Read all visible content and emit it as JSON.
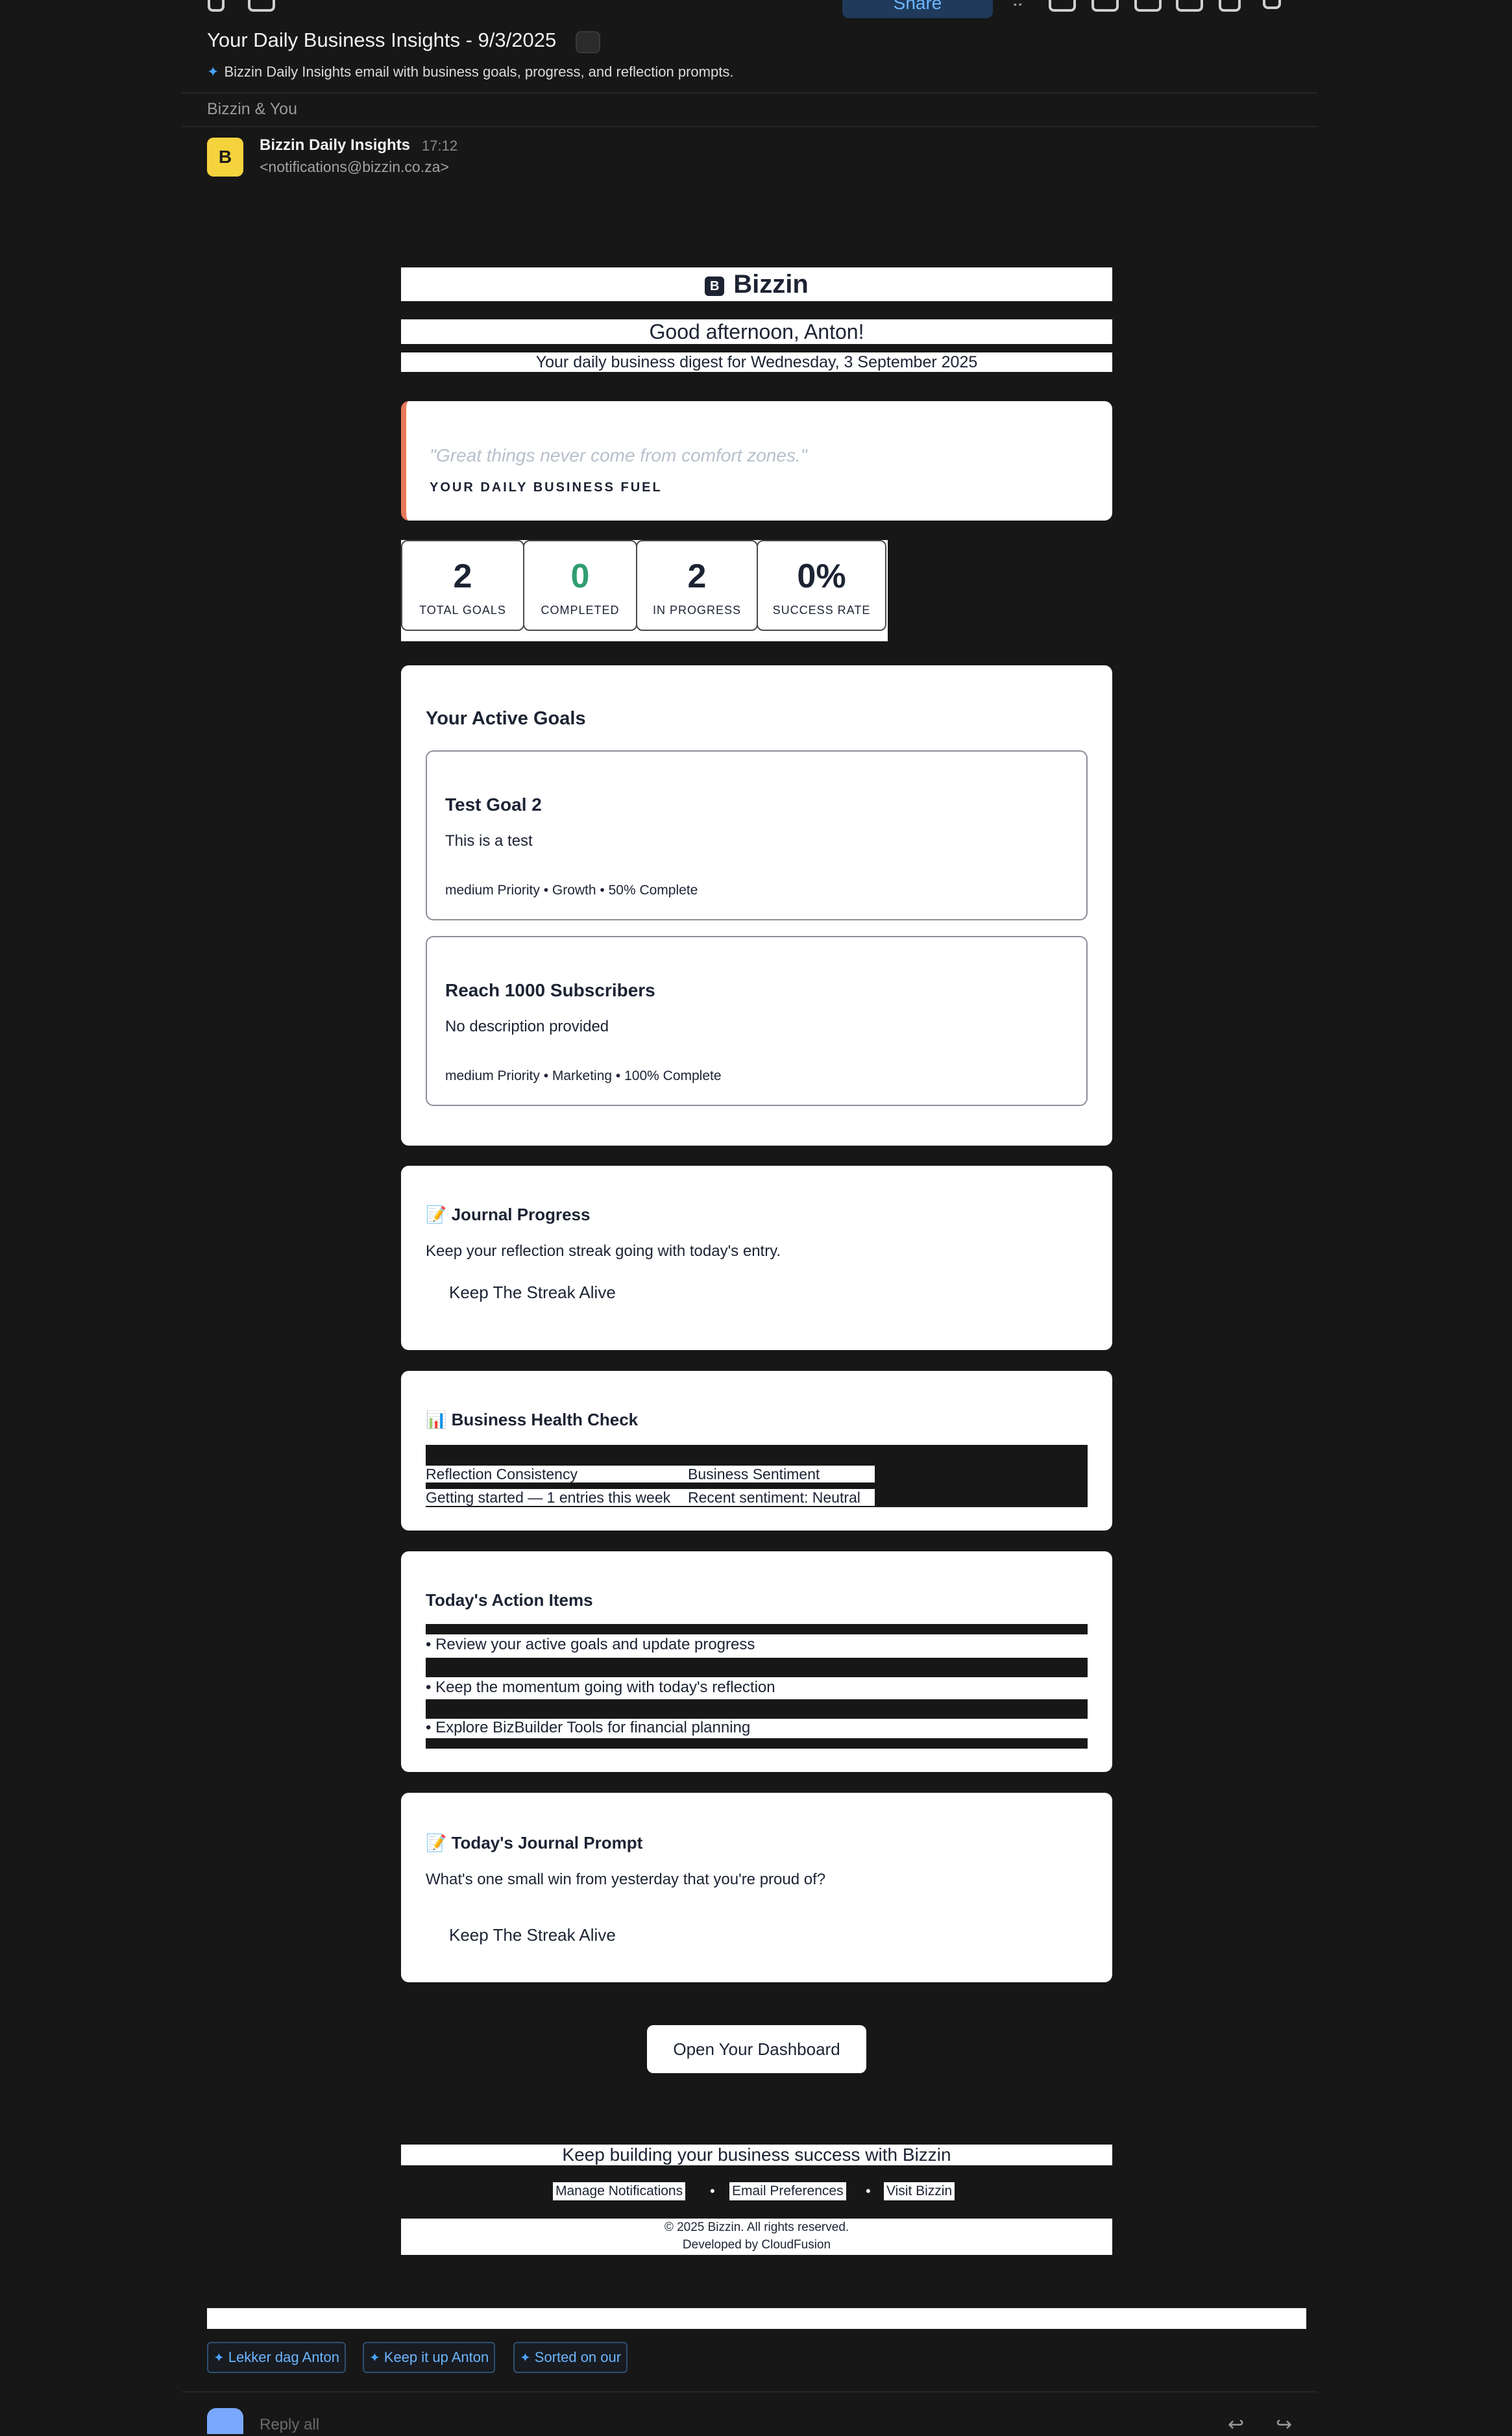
{
  "toolbar": {
    "share_label": "Share"
  },
  "header": {
    "subject": "Your Daily Business Insights - 9/3/2025",
    "summary": "Bizzin Daily Insights email with business goals, progress, and reflection prompts.",
    "thread_label": "Bizzin & You"
  },
  "sender": {
    "avatar_letter": "B",
    "name": "Bizzin Daily Insights",
    "time": "17:12",
    "email": "<notifications@bizzin.co.za>"
  },
  "email": {
    "brand": {
      "logo_letter": "B",
      "name": "Bizzin"
    },
    "greeting": "Good afternoon, Anton!",
    "digest": "Your daily business digest for Wednesday, 3 September 2025",
    "quote": {
      "text": "\"Great things never come from comfort zones.\"",
      "label": "YOUR DAILY BUSINESS FUEL"
    },
    "stats": [
      {
        "value": "2",
        "label": "TOTAL GOALS"
      },
      {
        "value": "0",
        "label": "COMPLETED"
      },
      {
        "value": "2",
        "label": "IN PROGRESS"
      },
      {
        "value": "0%",
        "label": "SUCCESS RATE"
      }
    ],
    "goals": {
      "title": "Your Active Goals",
      "items": [
        {
          "title": "Test Goal 2",
          "description": "This is a test",
          "meta": "medium Priority • Growth • 50% Complete"
        },
        {
          "title": "Reach 1000 Subscribers",
          "description": "No description provided",
          "meta": "medium Priority • Marketing • 100% Complete"
        }
      ]
    },
    "journal": {
      "title": "📝 Journal Progress",
      "text": "Keep your reflection streak going with today's entry.",
      "cta": "Keep The Streak Alive"
    },
    "health": {
      "title": "📊 Business Health Check",
      "col1_title": "Reflection Consistency",
      "col2_title": "Business Sentiment",
      "col1_value": "Getting started — 1 entries this week",
      "col2_value": "Recent sentiment: Neutral"
    },
    "actions": {
      "title": "Today's Action Items",
      "items": [
        "• Review your active goals and update progress",
        "• Keep the momentum going with today's reflection",
        "• Explore BizBuilder Tools for financial planning"
      ]
    },
    "prompt": {
      "title": "📝 Today's Journal Prompt",
      "text": "What's one small win from yesterday that you're proud of?",
      "cta": "Keep The Streak Alive"
    },
    "dashboard_button": "Open Your Dashboard",
    "footer": {
      "tagline": "Keep building your business success with Bizzin",
      "links": [
        "Manage Notifications",
        "Email Preferences",
        "Visit Bizzin"
      ],
      "separator": "•",
      "copyright": "© 2025 Bizzin. All rights reserved.",
      "developer": "Developed by CloudFusion"
    }
  },
  "suggested_replies": [
    "Lekker dag Anton",
    "Keep it up Anton",
    "Sorted on our"
  ],
  "composer": {
    "placeholder": "Reply all"
  },
  "colors": {
    "accent": "#6cb6ff",
    "quote_border": "#e8795a",
    "completed_green": "#2f9e6e",
    "avatar_yellow": "#f5d33d"
  },
  "icons": [
    "undo-icon",
    "archive-icon",
    "share-people-icon",
    "sync-icon",
    "more-icon",
    "tag-icon",
    "star-icon",
    "edit-icon",
    "clock-icon",
    "trash-icon",
    "chevron-down-icon",
    "sparkle-icon",
    "reply-icon",
    "forward-icon"
  ]
}
